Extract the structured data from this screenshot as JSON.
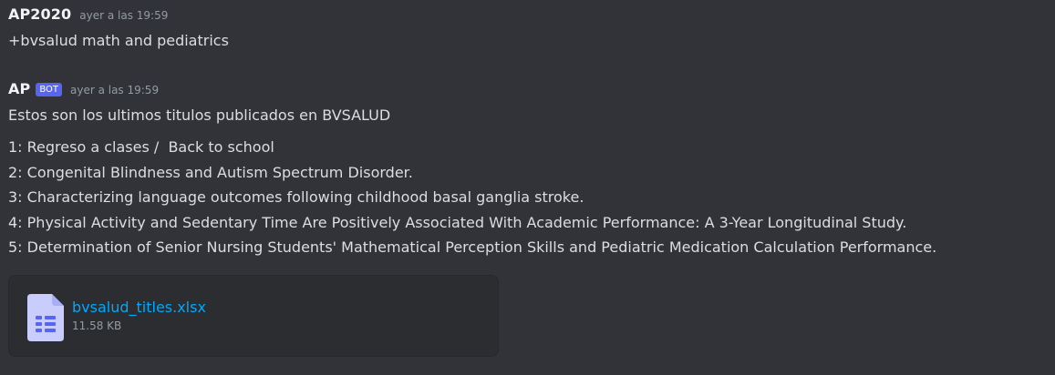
{
  "messages": [
    {
      "username": "AP2020",
      "timestamp": "ayer a las 19:59",
      "text": "+bvsalud math and pediatrics"
    },
    {
      "username": "AP",
      "bot_tag": "BOT",
      "timestamp": "ayer a las 19:59",
      "intro": "Estos son los ultimos titulos publicados en BVSALUD",
      "lines": [
        "1: Regreso a clases /  Back to school",
        "2: Congenital Blindness and Autism Spectrum Disorder.",
        "3: Characterizing language outcomes following childhood basal ganglia stroke.",
        "4: Physical Activity and Sedentary Time Are Positively Associated With Academic Performance: A 3-Year Longitudinal Study.",
        "5: Determination of Senior Nursing Students' Mathematical Perception Skills and Pediatric Medication Calculation Performance."
      ],
      "attachment": {
        "filename": "bvsalud_titles.xlsx",
        "size": "11.58 KB",
        "icon": "spreadsheet-file-icon"
      }
    }
  ],
  "colors": {
    "background": "#313338",
    "text": "#dbdee1",
    "username": "#f2f3f5",
    "timestamp": "#949ba4",
    "bot_tag": "#5865f2",
    "link": "#00a8fc",
    "attachment_bg": "#2b2d31",
    "file_icon": "#c9cdfb"
  }
}
